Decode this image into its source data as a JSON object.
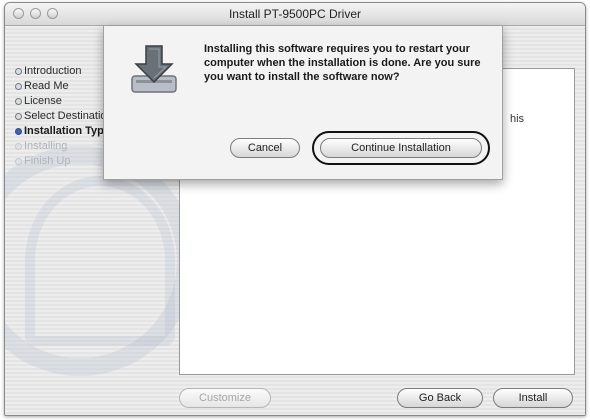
{
  "window": {
    "title": "Install PT-9500PC Driver"
  },
  "steps": [
    {
      "label": "Introduction",
      "state": "done"
    },
    {
      "label": "Read Me",
      "state": "done"
    },
    {
      "label": "License",
      "state": "done"
    },
    {
      "label": "Select Destination",
      "state": "done"
    },
    {
      "label": "Installation Type",
      "state": "current"
    },
    {
      "label": "Installing",
      "state": "pending"
    },
    {
      "label": "Finish Up",
      "state": "pending"
    }
  ],
  "panel": {
    "visible_tail_text": "his"
  },
  "footer": {
    "customize_label": "Customize",
    "go_back_label": "Go Back",
    "install_label": "Install"
  },
  "sheet": {
    "message": "Installing this software requires you to restart your computer when the installation is done.  Are you sure you want to install the software now?",
    "cancel_label": "Cancel",
    "continue_label": "Continue Installation"
  },
  "colors": {
    "current_step_bullet": "#3b66b7",
    "annotation_ring": "#111111"
  },
  "icons": {
    "installer": "package-download-icon"
  }
}
